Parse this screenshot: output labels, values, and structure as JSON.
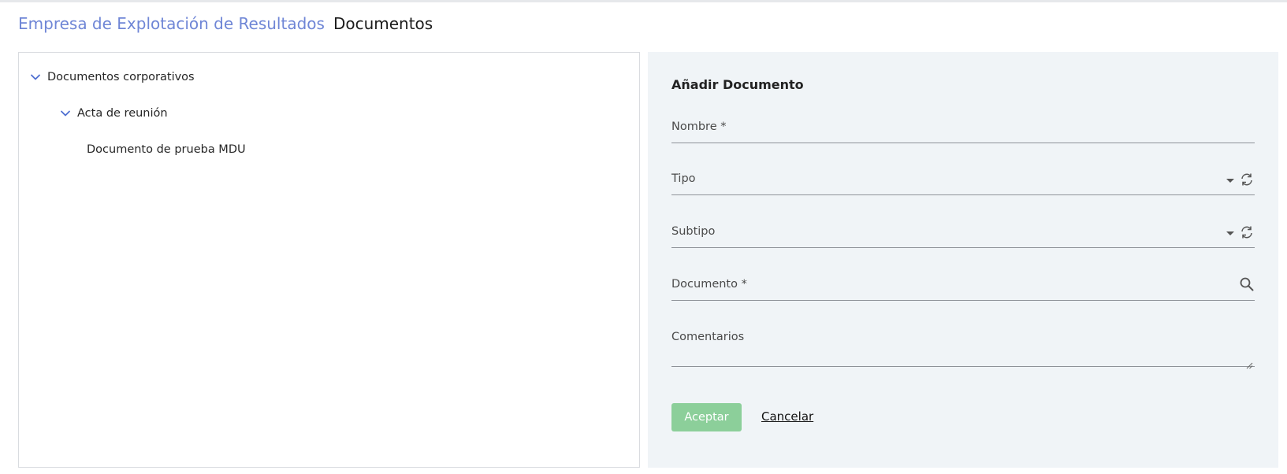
{
  "header": {
    "breadcrumb_link": "Empresa de Explotación de Resultados",
    "page_title": "Documentos"
  },
  "tree": {
    "root": {
      "label": "Documentos corporativos",
      "expanded": true
    },
    "child": {
      "label": "Acta de reunión",
      "expanded": true
    },
    "leaf": {
      "label": "Documento de prueba MDU"
    }
  },
  "form": {
    "title": "Añadir Documento",
    "fields": {
      "nombre": {
        "label": "Nombre *",
        "value": ""
      },
      "tipo": {
        "label": "Tipo",
        "value": ""
      },
      "subtipo": {
        "label": "Subtipo",
        "value": ""
      },
      "documento": {
        "label": "Documento *",
        "value": ""
      },
      "comentarios": {
        "label": "Comentarios",
        "value": ""
      }
    },
    "accept_label": "Aceptar",
    "cancel_label": "Cancelar"
  },
  "colors": {
    "accent": "#6f86d6",
    "accept_button": "#8ccf9a",
    "form_background": "#f0f4f7"
  },
  "icons": {
    "tree_toggle": "chevron-down-icon",
    "select_dropdown": "caret-down-icon",
    "refresh": "refresh-icon",
    "search": "search-icon"
  }
}
